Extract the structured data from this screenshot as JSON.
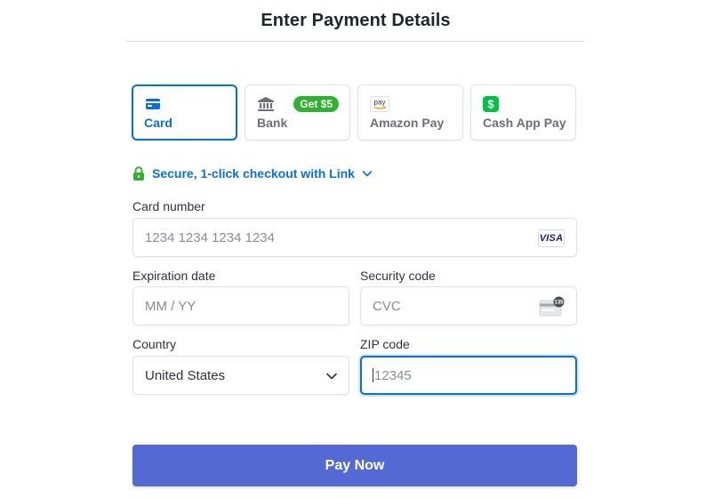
{
  "page": {
    "title": "Enter Payment Details"
  },
  "payment_methods": [
    {
      "label": "Card",
      "icon": "card-icon",
      "selected": true
    },
    {
      "label": "Bank",
      "icon": "bank-icon",
      "badge": "Get $5"
    },
    {
      "label": "Amazon Pay",
      "icon": "amazon-pay-icon",
      "icon_text": "pay"
    },
    {
      "label": "Cash App Pay",
      "icon": "cash-app-icon",
      "icon_text": "$"
    }
  ],
  "link": {
    "text": "Secure, 1-click checkout with Link",
    "icon": "lock-icon"
  },
  "form": {
    "card_number": {
      "label": "Card number",
      "placeholder": "1234 1234 1234 1234",
      "brand": "VISA"
    },
    "expiration": {
      "label": "Expiration date",
      "placeholder": "MM / YY"
    },
    "security_code": {
      "label": "Security code",
      "placeholder": "CVC",
      "icon_text": "135"
    },
    "country": {
      "label": "Country",
      "value": "United States"
    },
    "zip": {
      "label": "ZIP code",
      "placeholder": "12345"
    }
  },
  "pay_button": {
    "label": "Pay Now"
  },
  "colors": {
    "accent": "#0570de",
    "button": "#5469d4",
    "badge": "#30b130",
    "lock": "#30b130",
    "text": "#30313d",
    "muted": "#6d6e78"
  }
}
